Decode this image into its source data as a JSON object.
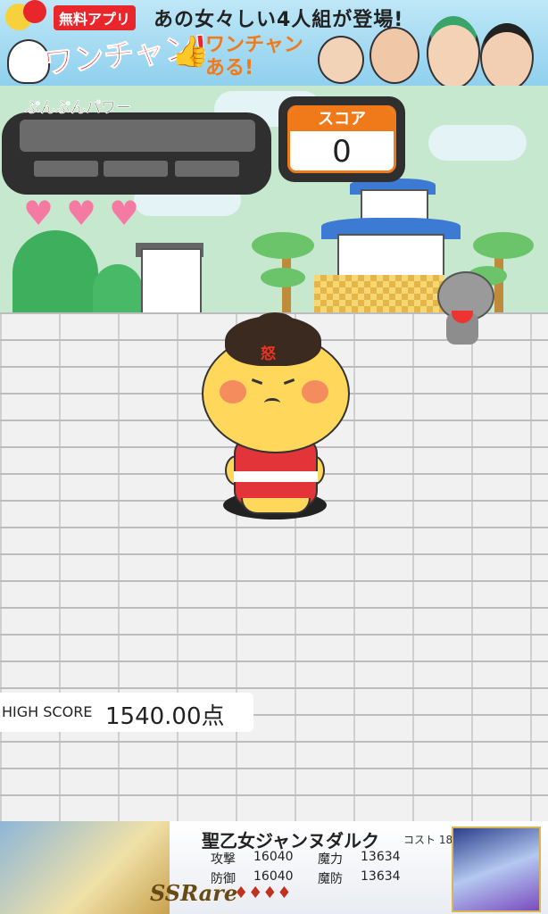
{
  "top_ad": {
    "badge": "無料アプリ",
    "headline": "あの女々しい4人組が登場!",
    "logo": "ワンチャン!",
    "sub_line1": "ワンチャン",
    "sub_line2": "ある!"
  },
  "hud": {
    "power_label": "ぷんぷんパワー",
    "score_label": "スコア",
    "score_value": "0",
    "lives": 3,
    "anger_glyph": "怒"
  },
  "high_score": {
    "label": "HIGH SCORE",
    "value": "1540.00点"
  },
  "bottom_ad": {
    "card_name": "聖乙女ジャンヌダルク",
    "cost": "コスト 18",
    "stats": [
      {
        "label": "攻撃",
        "value": "16040"
      },
      {
        "label": "魔力",
        "value": "13634"
      },
      {
        "label": "防御",
        "value": "16040"
      },
      {
        "label": "魔防",
        "value": "13634"
      }
    ],
    "rarity": "SSRare",
    "stars": "♦♦♦♦"
  },
  "colors": {
    "accent_orange": "#f07a1a",
    "heart_pink": "#f47aa4",
    "sky": "#c5e8cf"
  }
}
